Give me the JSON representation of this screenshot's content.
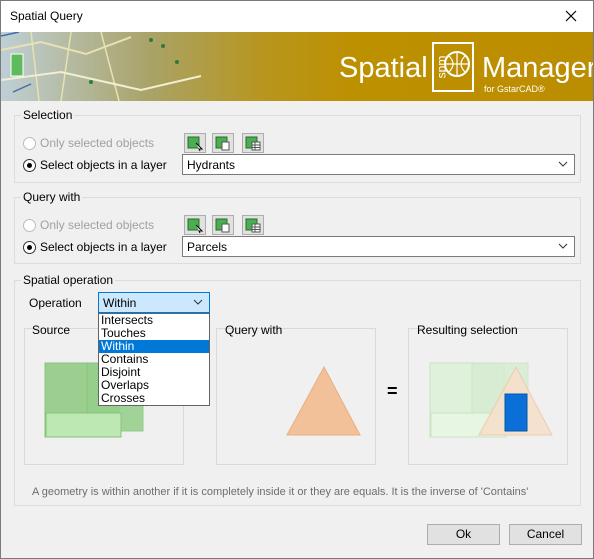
{
  "window": {
    "title": "Spatial Query"
  },
  "banner": {
    "brand_left": "Spatial",
    "brand_logo": "spm",
    "brand_right": "Manager",
    "brand_sub": "for GstarCAD®"
  },
  "selection": {
    "label": "Selection",
    "opt_selected": "Only selected objects",
    "opt_layer": "Select objects in a layer",
    "layer_value": "Hydrants"
  },
  "query_with": {
    "label": "Query with",
    "opt_selected": "Only selected objects",
    "opt_layer": "Select objects in a layer",
    "layer_value": "Parcels"
  },
  "spatial_operation": {
    "label": "Spatial operation",
    "operation_label": "Operation",
    "operation_value": "Within",
    "options": [
      "Intersects",
      "Touches",
      "Within",
      "Contains",
      "Disjoint",
      "Overlaps",
      "Crosses"
    ],
    "selected_option": "Within",
    "source_label": "Source",
    "query_label": "Query with",
    "result_label": "Resulting selection",
    "equals": "=",
    "description": "A geometry is within another if it is completely inside it or they are equals. It is the inverse of 'Contains'"
  },
  "buttons": {
    "ok": "Ok",
    "cancel": "Cancel"
  },
  "colors": {
    "accent": "#0078d7",
    "banner_gold": "#bb8d00",
    "source_green": "#9ccf8f",
    "triangle": "#f2c199",
    "result_blue": "#0a6fd6"
  }
}
